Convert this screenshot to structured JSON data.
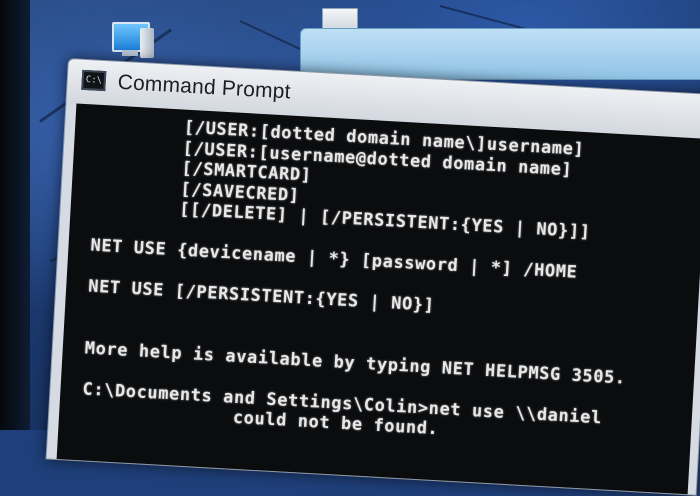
{
  "window": {
    "title": "Command Prompt",
    "icon_text": "C:\\"
  },
  "console": {
    "lines": [
      "        [/USER:[dotted domain name\\]username]",
      "        [/USER:[username@dotted domain name]",
      "        [/SMARTCARD]",
      "        [/SAVECRED]",
      "        [[/DELETE] | [/PERSISTENT:{YES | NO}]]",
      "",
      "NET USE {devicename | *} [password | *] /HOME",
      "",
      "NET USE [/PERSISTENT:{YES | NO}]",
      "",
      "",
      "More help is available by typing NET HELPMSG 3505.",
      "",
      "C:\\Documents and Settings\\Colin>net use \\\\daniel",
      "              could not be found."
    ]
  },
  "colors": {
    "console_bg": "#0b0c0e",
    "console_text": "#e8e8e8",
    "desktop": "#1f3f7a"
  }
}
